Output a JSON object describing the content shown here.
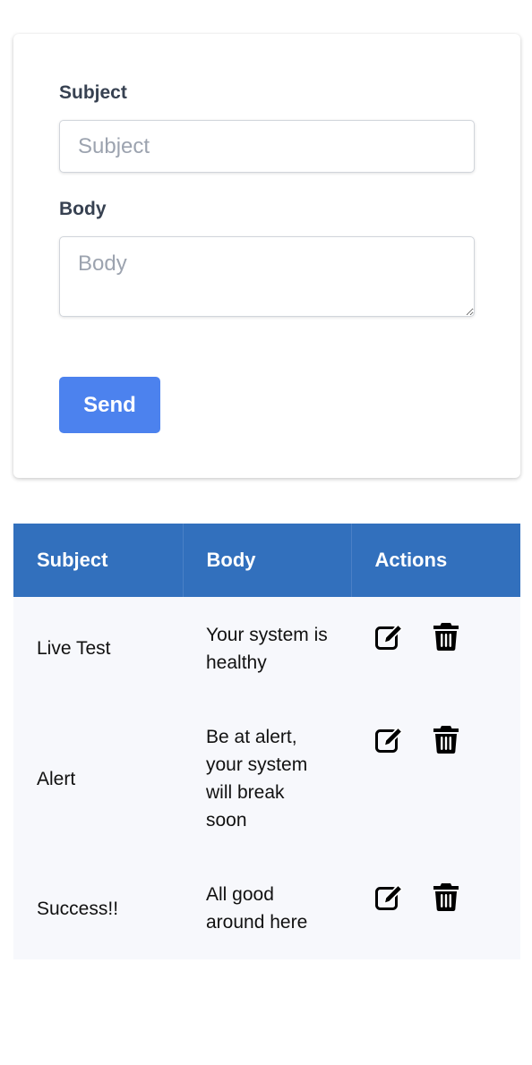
{
  "form": {
    "subject_label": "Subject",
    "subject_placeholder": "Subject",
    "subject_value": "",
    "body_label": "Body",
    "body_placeholder": "Body",
    "body_value": "",
    "send_label": "Send",
    "send_color": "#4c82ee"
  },
  "table": {
    "header_color": "#3270bd",
    "columns": [
      "Subject",
      "Body",
      "Actions"
    ],
    "rows": [
      {
        "subject": "Live Test",
        "body": "Your system is healthy",
        "actions": [
          "edit-icon",
          "trash-icon"
        ]
      },
      {
        "subject": "Alert",
        "body": "Be at alert, your system will break soon",
        "actions": [
          "edit-icon",
          "trash-icon"
        ]
      },
      {
        "subject": "Success!!",
        "body": "All good around here",
        "actions": [
          "edit-icon",
          "trash-icon"
        ]
      }
    ]
  }
}
